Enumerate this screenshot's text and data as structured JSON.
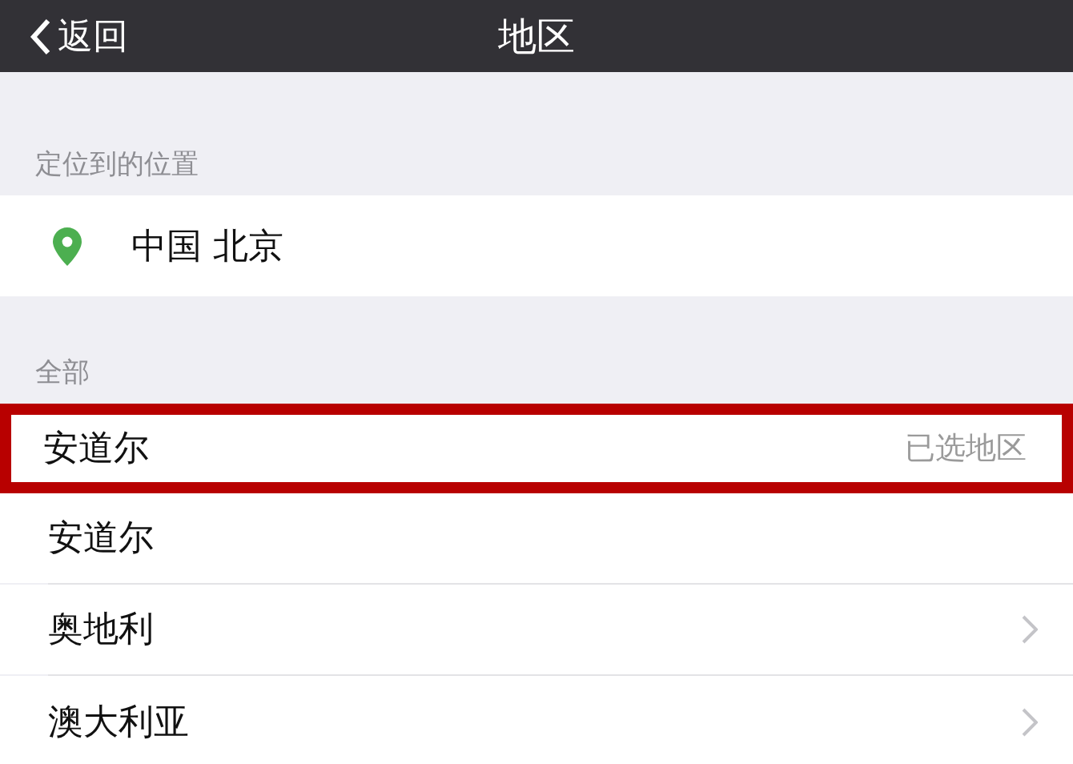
{
  "nav_bar": {
    "back_label": "返回",
    "title": "地区"
  },
  "location_section": {
    "header": "定位到的位置",
    "location": "中国 北京"
  },
  "all_section": {
    "header": "全部",
    "rows": [
      {
        "name": "安道尔",
        "note": "已选地区",
        "highlighted": true,
        "chevron": false
      },
      {
        "name": "安道尔",
        "highlighted": false,
        "chevron": false
      },
      {
        "name": "奥地利",
        "highlighted": false,
        "chevron": true
      },
      {
        "name": "澳大利亚",
        "highlighted": false,
        "chevron": true
      }
    ]
  }
}
